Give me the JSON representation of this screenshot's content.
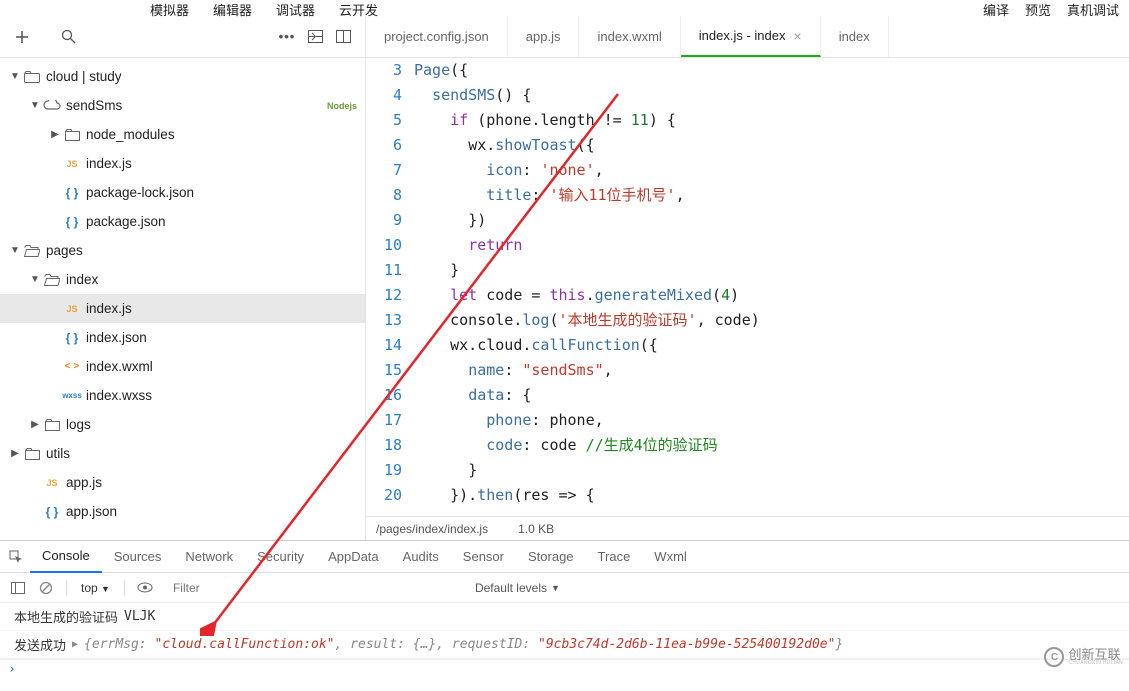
{
  "top_menu": {
    "left": [
      "模拟器",
      "编辑器",
      "调试器",
      "云开发"
    ],
    "right": [
      "编译",
      "预览",
      "真机调试"
    ]
  },
  "sidebar": {
    "items": [
      {
        "label": "cloud | study",
        "type": "cloud-root",
        "depth": 0,
        "expanded": true
      },
      {
        "label": "sendSms",
        "type": "cloud-fn",
        "depth": 1,
        "expanded": true,
        "badge": "Nodejs"
      },
      {
        "label": "node_modules",
        "type": "folder",
        "depth": 2,
        "expanded": false,
        "chev": true
      },
      {
        "label": "index.js",
        "type": "js",
        "depth": 2
      },
      {
        "label": "package-lock.json",
        "type": "json",
        "depth": 2
      },
      {
        "label": "package.json",
        "type": "json",
        "depth": 2
      },
      {
        "label": "pages",
        "type": "folder-open",
        "depth": 0,
        "expanded": true
      },
      {
        "label": "index",
        "type": "folder-open",
        "depth": 1,
        "expanded": true
      },
      {
        "label": "index.js",
        "type": "js",
        "depth": 2,
        "selected": true
      },
      {
        "label": "index.json",
        "type": "json",
        "depth": 2
      },
      {
        "label": "index.wxml",
        "type": "wxml",
        "depth": 2
      },
      {
        "label": "index.wxss",
        "type": "wxss",
        "depth": 2
      },
      {
        "label": "logs",
        "type": "folder",
        "depth": 1,
        "expanded": false,
        "chev": true
      },
      {
        "label": "utils",
        "type": "folder",
        "depth": 0,
        "expanded": false,
        "chev": true
      },
      {
        "label": "app.js",
        "type": "js",
        "depth": 1
      },
      {
        "label": "app.json",
        "type": "json",
        "depth": 1
      }
    ]
  },
  "editor": {
    "tabs": [
      {
        "label": "project.config.json"
      },
      {
        "label": "app.js"
      },
      {
        "label": "index.wxml"
      },
      {
        "label": "index.js",
        "suffix": " - index",
        "active": true,
        "close": true
      },
      {
        "label": "index"
      }
    ],
    "lines": [
      {
        "n": 3,
        "html": "<span class='tk-fn'>Page</span><span class='tk-plain'>({</span>"
      },
      {
        "n": 4,
        "html": "  <span class='tk-fn'>sendSMS</span><span class='tk-plain'>() {</span>"
      },
      {
        "n": 5,
        "html": "    <span class='tk-kw'>if</span> <span class='tk-plain'>(phone.length != </span><span class='tk-num'>11</span><span class='tk-plain'>) {</span>"
      },
      {
        "n": 6,
        "html": "      <span class='tk-plain'>wx.</span><span class='tk-fn'>showToast</span><span class='tk-plain'>({</span>"
      },
      {
        "n": 7,
        "html": "        <span class='tk-prop'>icon</span><span class='tk-plain'>: </span><span class='tk-str'>'none'</span><span class='tk-plain'>,</span>"
      },
      {
        "n": 8,
        "html": "        <span class='tk-prop'>title</span><span class='tk-plain'>: </span><span class='tk-str'>'输入11位手机号'</span><span class='tk-plain'>,</span>"
      },
      {
        "n": 9,
        "html": "      <span class='tk-plain'>})</span>"
      },
      {
        "n": 10,
        "html": "      <span class='tk-kw'>return</span>"
      },
      {
        "n": 11,
        "html": "    <span class='tk-plain'>}</span>"
      },
      {
        "n": 12,
        "html": "    <span class='tk-kw'>let</span> <span class='tk-plain'>code = </span><span class='tk-kw'>this</span><span class='tk-plain'>.</span><span class='tk-fn'>generateMixed</span><span class='tk-plain'>(</span><span class='tk-num'>4</span><span class='tk-plain'>)</span>"
      },
      {
        "n": 13,
        "html": "    <span class='tk-plain'>console.</span><span class='tk-fn'>log</span><span class='tk-plain'>(</span><span class='tk-str'>'本地生成的验证码'</span><span class='tk-plain'>, code)</span>"
      },
      {
        "n": 14,
        "html": "    <span class='tk-plain'>wx.cloud.</span><span class='tk-fn'>callFunction</span><span class='tk-plain'>({</span>"
      },
      {
        "n": 15,
        "html": "      <span class='tk-prop'>name</span><span class='tk-plain'>: </span><span class='tk-str'>\"sendSms\"</span><span class='tk-plain'>,</span>"
      },
      {
        "n": 16,
        "html": "      <span class='tk-prop'>data</span><span class='tk-plain'>: {</span>"
      },
      {
        "n": 17,
        "html": "        <span class='tk-prop'>phone</span><span class='tk-plain'>: phone,</span>"
      },
      {
        "n": 18,
        "html": "        <span class='tk-prop'>code</span><span class='tk-plain'>: code </span><span class='tk-com'>//生成4位的验证码</span>"
      },
      {
        "n": 19,
        "html": "      <span class='tk-plain'>}</span>"
      },
      {
        "n": 20,
        "html": "    <span class='tk-plain'>}).</span><span class='tk-fn'>then</span><span class='tk-plain'>(res =&gt; {</span>"
      }
    ],
    "status": {
      "path": "/pages/index/index.js",
      "size": "1.0 KB"
    }
  },
  "devtools": {
    "tabs": [
      "Console",
      "Sources",
      "Network",
      "Security",
      "AppData",
      "Audits",
      "Sensor",
      "Storage",
      "Trace",
      "Wxml"
    ],
    "active_tab": "Console",
    "filter_placeholder": "Filter",
    "context": "top",
    "levels": "Default levels",
    "console": {
      "line1_prefix": "本地生成的验证码",
      "line1_value": "VLJK",
      "line2_prefix": "发送成功",
      "line2_obj_open": "{",
      "line2_errmsg_key": "errMsg:",
      "line2_errmsg_val": "\"cloud.callFunction:ok\"",
      "line2_result": ", result: {…}, requestID:",
      "line2_reqid_val": "\"9cb3c74d-2d6b-11ea-b99e-525400192d0e\"",
      "line2_obj_close": "}"
    }
  },
  "watermark": {
    "text": "创新互联",
    "sub": "CHUANGXIN HULIAN"
  }
}
